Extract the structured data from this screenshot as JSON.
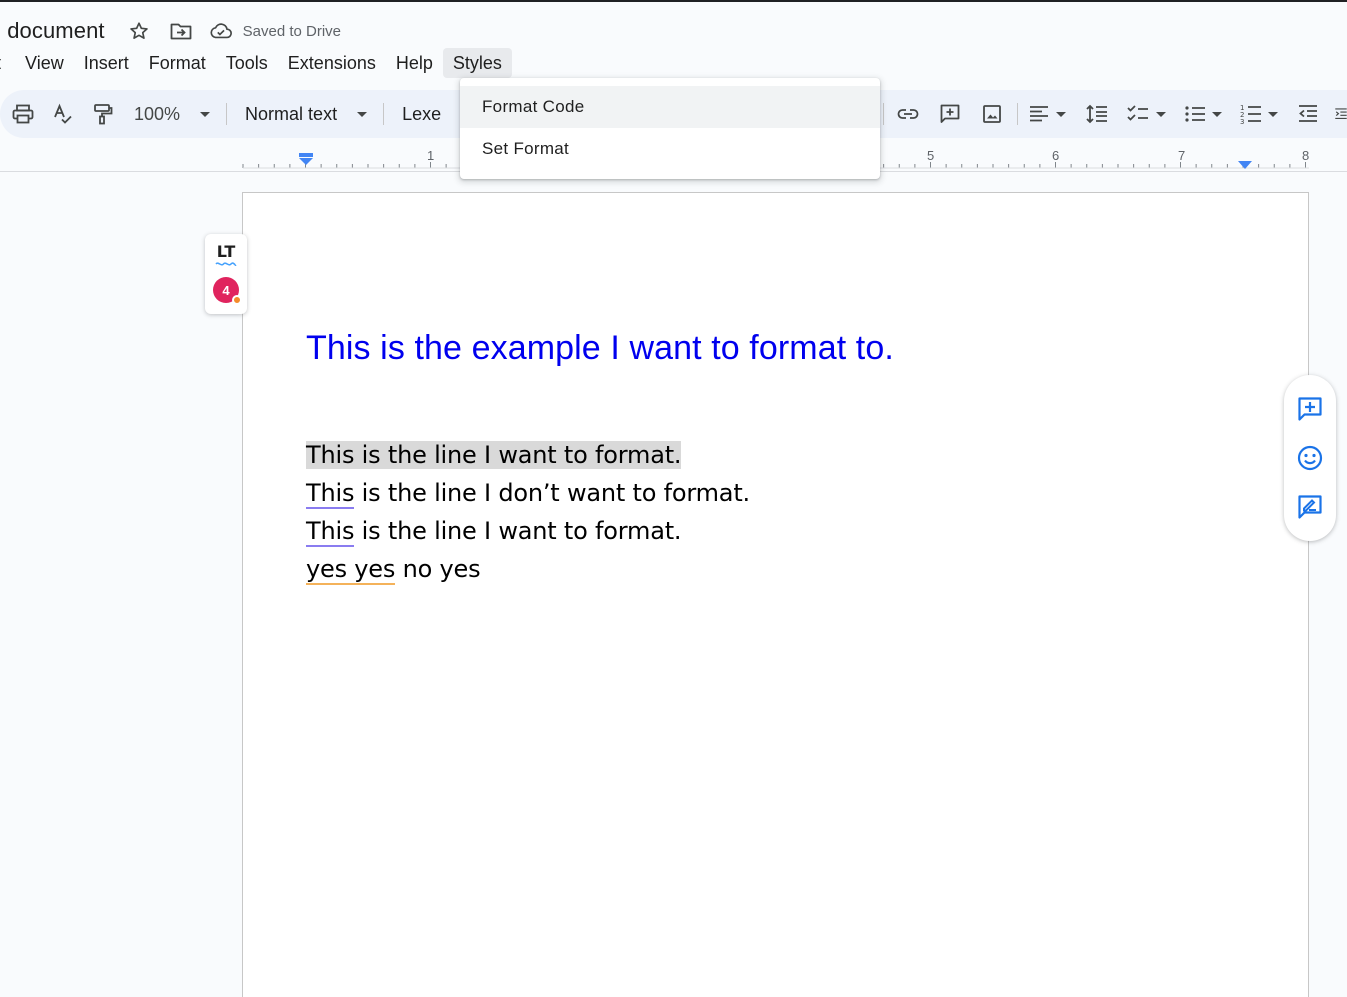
{
  "titlebar": {
    "doc_title": "l document",
    "save_status": "Saved to Drive"
  },
  "menu": {
    "items": [
      {
        "label": "t"
      },
      {
        "label": "View"
      },
      {
        "label": "Insert"
      },
      {
        "label": "Format"
      },
      {
        "label": "Tools"
      },
      {
        "label": "Extensions"
      },
      {
        "label": "Help"
      },
      {
        "label": "Styles"
      }
    ]
  },
  "toolbar": {
    "zoom": "100%",
    "paragraph_style": "Normal text",
    "font": "Lexe"
  },
  "ruler": {
    "numbers": [
      "1",
      "5",
      "6",
      "7",
      "8"
    ]
  },
  "dropdown": {
    "items": [
      {
        "label": "Format Code"
      },
      {
        "label": "Set Format"
      }
    ]
  },
  "document": {
    "heading": "This is the example I want to format to.",
    "line1": "This is the line I want to format.",
    "line2_a": "This",
    "line2_b": " is the line I don’t want to format.",
    "line3_a": "This",
    "line3_b": " is the line I want to format.",
    "line4_a": "yes yes",
    "line4_b": " no yes",
    "heading_color": "#0000ee",
    "highlight_color": "#d9d9d9"
  },
  "languagetool": {
    "logo": "LT",
    "issues": "4"
  }
}
